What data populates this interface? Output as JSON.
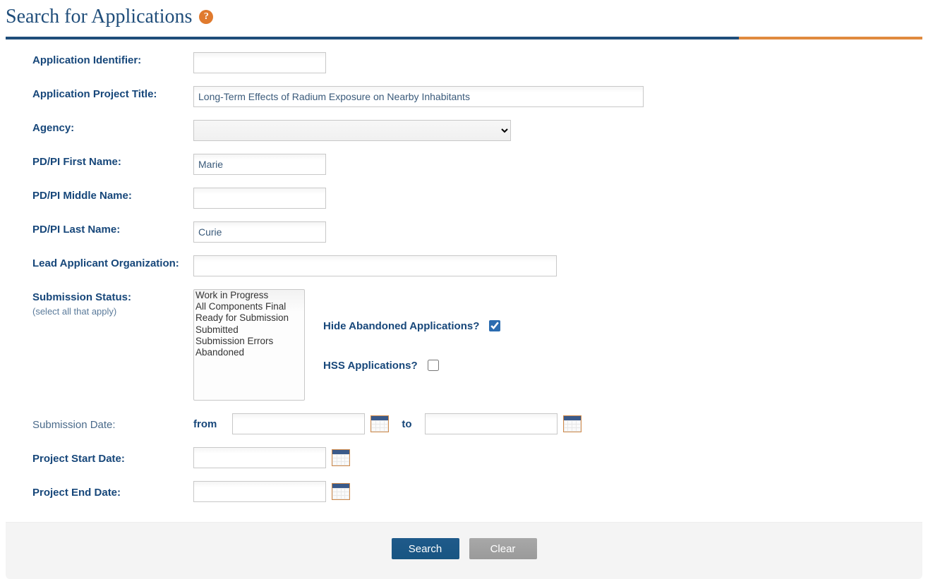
{
  "header": {
    "title": "Search for Applications",
    "help_glyph": "?"
  },
  "labels": {
    "app_id": "Application Identifier:",
    "project_title": "Application Project Title:",
    "agency": "Agency:",
    "pi_first": "PD/PI First Name:",
    "pi_middle": "PD/PI Middle Name:",
    "pi_last": "PD/PI Last Name:",
    "lead_org": "Lead Applicant Organization:",
    "submission_status": "Submission Status:",
    "submission_status_sub": "(select all that apply)",
    "hide_abandoned": "Hide Abandoned Applications?",
    "hss": "HSS Applications?",
    "submission_date": "Submission Date:",
    "from": "from",
    "to": "to",
    "project_start": "Project Start Date:",
    "project_end": "Project End Date:"
  },
  "values": {
    "app_id": "",
    "project_title": "Long-Term Effects of Radium Exposure on Nearby Inhabitants",
    "agency": "",
    "pi_first": "Marie",
    "pi_middle": "",
    "pi_last": "Curie",
    "lead_org": "",
    "hide_abandoned_checked": true,
    "hss_checked": false,
    "submission_date_from": "",
    "submission_date_to": "",
    "project_start": "",
    "project_end": ""
  },
  "status_options": [
    "Work in Progress",
    "All Components Final",
    "Ready for Submission",
    "Submitted",
    "Submission Errors",
    "Abandoned"
  ],
  "buttons": {
    "search": "Search",
    "clear": "Clear"
  }
}
